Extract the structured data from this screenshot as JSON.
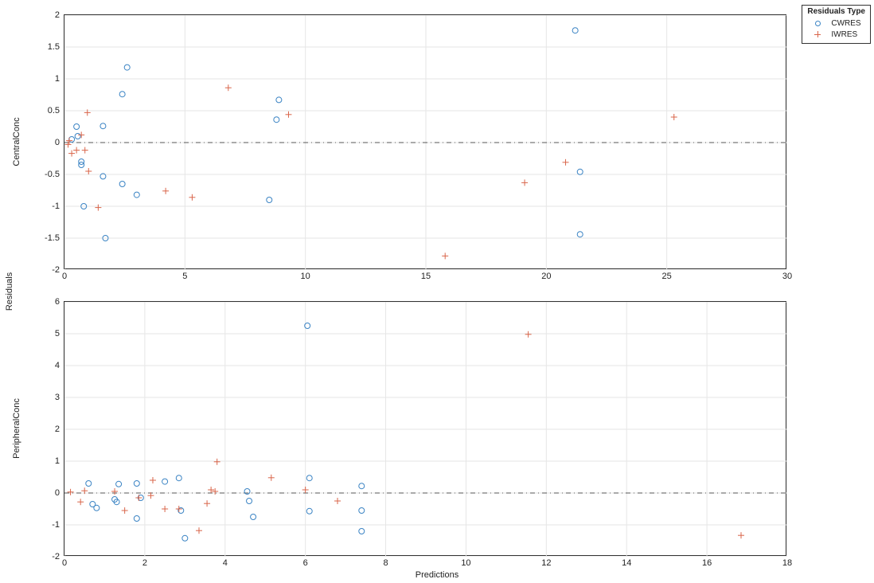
{
  "overall": {
    "xlabel": "Predictions",
    "ylabel": "Residuals"
  },
  "legend": {
    "title": "Residuals Type",
    "items": [
      {
        "name": "CWRES",
        "marker": "circle",
        "color": "#3b84c4"
      },
      {
        "name": "IWRES",
        "marker": "plus",
        "color": "#d9654a"
      }
    ]
  },
  "colors": {
    "cwres": "#3b84c4",
    "iwres": "#d9654a",
    "grid": "#e6e6e6"
  },
  "chart_data": [
    {
      "type": "scatter",
      "title": "CentralConc",
      "xlabel": "",
      "ylabel": "CentralConc",
      "xlim": [
        0,
        30
      ],
      "ylim": [
        -2,
        2
      ],
      "xticks": [
        0,
        5,
        10,
        15,
        20,
        25,
        30
      ],
      "yticks": [
        -2,
        -1.5,
        -1,
        -0.5,
        0,
        0.5,
        1,
        1.5,
        2
      ],
      "reference_y": 0,
      "series": [
        {
          "name": "CWRES",
          "marker": "circle",
          "color": "#3b84c4",
          "points": [
            {
              "x": 0.3,
              "y": 0.05
            },
            {
              "x": 0.5,
              "y": 0.25
            },
            {
              "x": 0.55,
              "y": 0.1
            },
            {
              "x": 0.7,
              "y": -0.3
            },
            {
              "x": 0.7,
              "y": -0.35
            },
            {
              "x": 0.8,
              "y": -1.0
            },
            {
              "x": 1.6,
              "y": 0.26
            },
            {
              "x": 1.6,
              "y": -0.53
            },
            {
              "x": 1.7,
              "y": -1.5
            },
            {
              "x": 2.4,
              "y": 0.76
            },
            {
              "x": 2.4,
              "y": -0.65
            },
            {
              "x": 2.6,
              "y": 1.18
            },
            {
              "x": 3.0,
              "y": -0.82
            },
            {
              "x": 8.5,
              "y": -0.9
            },
            {
              "x": 8.8,
              "y": 0.36
            },
            {
              "x": 8.9,
              "y": 0.67
            },
            {
              "x": 21.2,
              "y": 1.76
            },
            {
              "x": 21.4,
              "y": -0.46
            },
            {
              "x": 21.4,
              "y": -1.44
            }
          ]
        },
        {
          "name": "IWRES",
          "marker": "plus",
          "color": "#d9654a",
          "points": [
            {
              "x": 0.15,
              "y": -0.03
            },
            {
              "x": 0.2,
              "y": 0.03
            },
            {
              "x": 0.3,
              "y": -0.17
            },
            {
              "x": 0.5,
              "y": -0.12
            },
            {
              "x": 0.7,
              "y": 0.12
            },
            {
              "x": 0.85,
              "y": -0.12
            },
            {
              "x": 0.95,
              "y": 0.47
            },
            {
              "x": 1.0,
              "y": -0.45
            },
            {
              "x": 1.4,
              "y": -1.02
            },
            {
              "x": 4.2,
              "y": -0.76
            },
            {
              "x": 5.3,
              "y": -0.86
            },
            {
              "x": 6.8,
              "y": 0.86
            },
            {
              "x": 9.3,
              "y": 0.44
            },
            {
              "x": 15.8,
              "y": -1.78
            },
            {
              "x": 19.1,
              "y": -0.63
            },
            {
              "x": 20.8,
              "y": -0.31
            },
            {
              "x": 25.3,
              "y": 0.4
            }
          ]
        }
      ]
    },
    {
      "type": "scatter",
      "title": "PeripheralConc",
      "xlabel": "",
      "ylabel": "PeripheralConc",
      "xlim": [
        0,
        18
      ],
      "ylim": [
        -2,
        6
      ],
      "xticks": [
        0,
        2,
        4,
        6,
        8,
        10,
        12,
        14,
        16,
        18
      ],
      "yticks": [
        -2,
        -1,
        0,
        1,
        2,
        3,
        4,
        5,
        6
      ],
      "reference_y": 0,
      "series": [
        {
          "name": "CWRES",
          "marker": "circle",
          "color": "#3b84c4",
          "points": [
            {
              "x": 0.6,
              "y": 0.3
            },
            {
              "x": 0.7,
              "y": -0.35
            },
            {
              "x": 0.8,
              "y": -0.47
            },
            {
              "x": 1.25,
              "y": -0.2
            },
            {
              "x": 1.3,
              "y": -0.28
            },
            {
              "x": 1.35,
              "y": 0.28
            },
            {
              "x": 1.8,
              "y": 0.3
            },
            {
              "x": 1.8,
              "y": -0.8
            },
            {
              "x": 1.9,
              "y": -0.15
            },
            {
              "x": 2.5,
              "y": 0.36
            },
            {
              "x": 2.85,
              "y": 0.47
            },
            {
              "x": 2.9,
              "y": -0.55
            },
            {
              "x": 3.0,
              "y": -1.42
            },
            {
              "x": 4.55,
              "y": 0.05
            },
            {
              "x": 4.6,
              "y": -0.25
            },
            {
              "x": 4.7,
              "y": -0.75
            },
            {
              "x": 6.05,
              "y": 5.25
            },
            {
              "x": 6.1,
              "y": 0.47
            },
            {
              "x": 6.1,
              "y": -0.57
            },
            {
              "x": 7.4,
              "y": 0.22
            },
            {
              "x": 7.4,
              "y": -0.55
            },
            {
              "x": 7.4,
              "y": -1.2
            }
          ]
        },
        {
          "name": "IWRES",
          "marker": "plus",
          "color": "#d9654a",
          "points": [
            {
              "x": 0.15,
              "y": 0.03
            },
            {
              "x": 0.4,
              "y": -0.28
            },
            {
              "x": 0.5,
              "y": 0.07
            },
            {
              "x": 1.25,
              "y": 0.05
            },
            {
              "x": 1.5,
              "y": -0.55
            },
            {
              "x": 1.85,
              "y": -0.15
            },
            {
              "x": 2.15,
              "y": -0.08
            },
            {
              "x": 2.2,
              "y": 0.4
            },
            {
              "x": 2.5,
              "y": -0.5
            },
            {
              "x": 2.85,
              "y": -0.5
            },
            {
              "x": 3.35,
              "y": -1.18
            },
            {
              "x": 3.55,
              "y": -0.33
            },
            {
              "x": 3.65,
              "y": 0.1
            },
            {
              "x": 3.75,
              "y": 0.05
            },
            {
              "x": 3.8,
              "y": 0.98
            },
            {
              "x": 5.15,
              "y": 0.48
            },
            {
              "x": 6.0,
              "y": 0.1
            },
            {
              "x": 6.8,
              "y": -0.25
            },
            {
              "x": 11.55,
              "y": 4.98
            },
            {
              "x": 16.85,
              "y": -1.33
            }
          ]
        }
      ]
    }
  ]
}
